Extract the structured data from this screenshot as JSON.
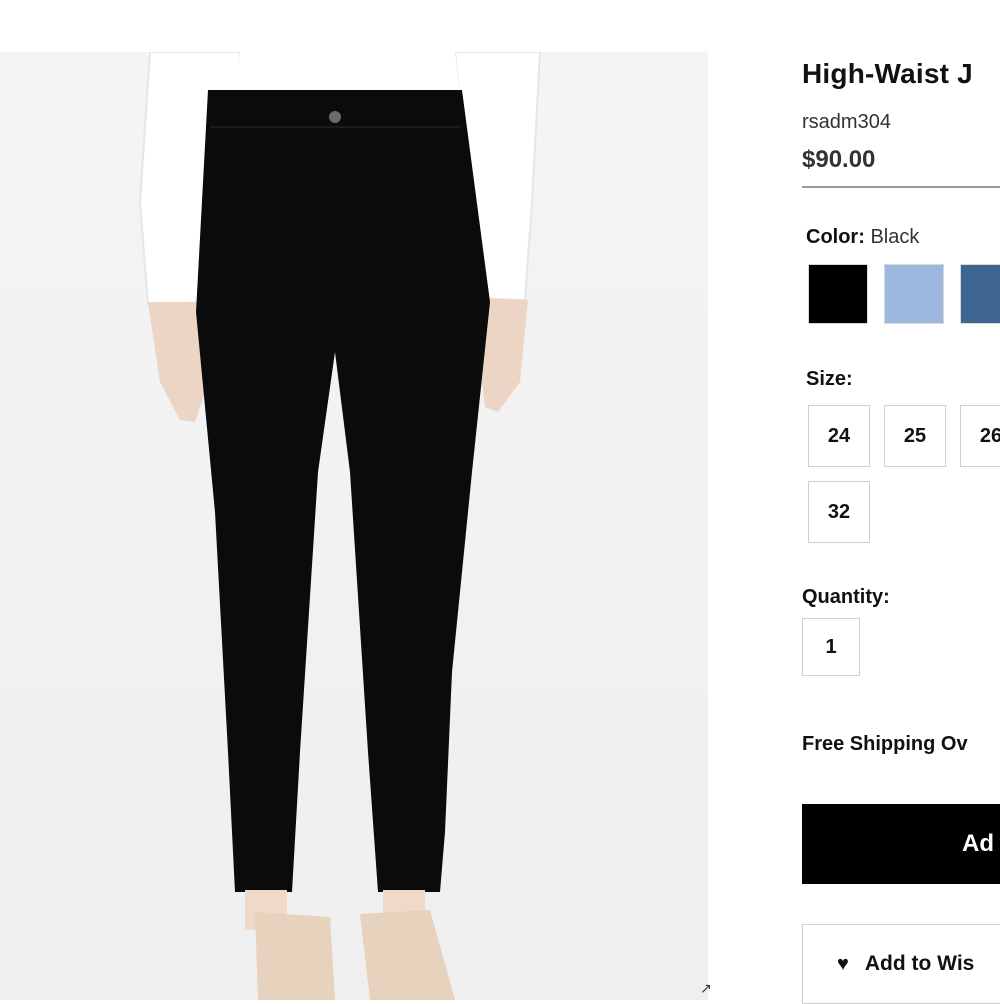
{
  "product": {
    "title": "High-Waist J",
    "sku": "rsadm304",
    "price": "$90.00"
  },
  "color": {
    "label": "Color:",
    "selected": "Black",
    "swatches": [
      {
        "name": "Black",
        "hex": "#000000"
      },
      {
        "name": "light-blue",
        "hex": "#9db8de"
      },
      {
        "name": "medium-blue",
        "hex": "#3f6690"
      }
    ]
  },
  "size": {
    "label": "Size:",
    "options": [
      "24",
      "25",
      "26",
      "32"
    ]
  },
  "quantity": {
    "label": "Quantity:",
    "value": "1"
  },
  "shipping_text": "Free Shipping Ov",
  "buttons": {
    "add_to_cart": "Ad",
    "wishlist": "Add to Wis",
    "wishlist_icon": "heart-icon"
  },
  "photo": {
    "expand_icon": "expand-icon"
  }
}
